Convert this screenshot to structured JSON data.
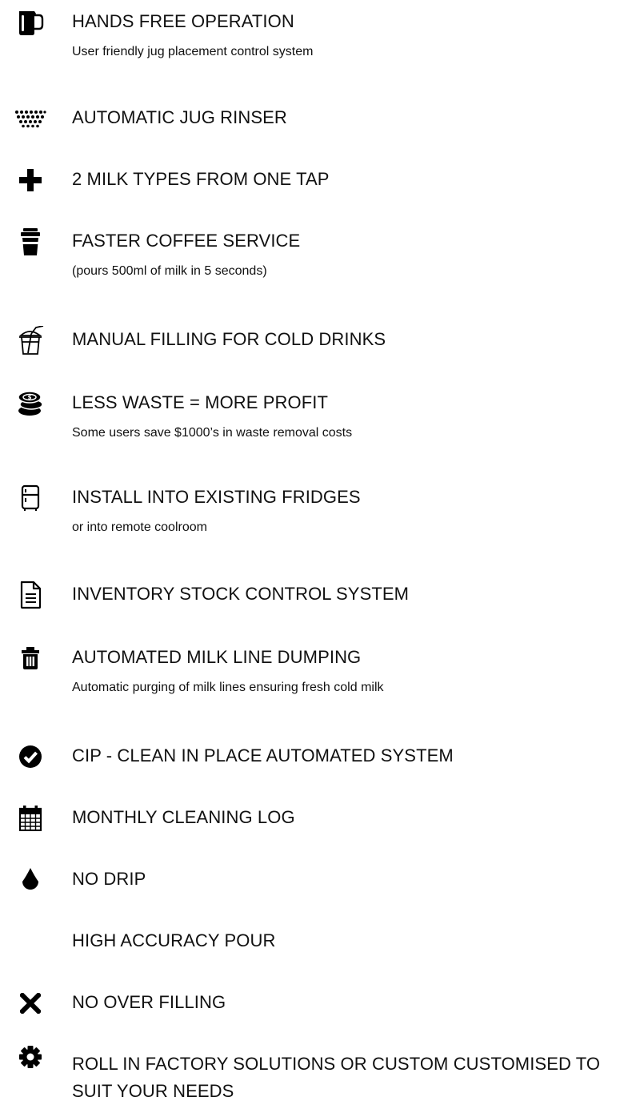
{
  "features": [
    {
      "icon": "milk-jug-icon",
      "title": "HANDS FREE OPERATION",
      "subtitle": "User friendly jug placement control system"
    },
    {
      "icon": "water-spray-icon",
      "title": "AUTOMATIC JUG RINSER"
    },
    {
      "icon": "plus-icon",
      "title": "2 MILK TYPES FROM ONE TAP"
    },
    {
      "icon": "takeaway-cup-icon",
      "title": "FASTER COFFEE SERVICE",
      "subtitle": "(pours 500ml of milk in 5 seconds)"
    },
    {
      "icon": "cold-drink-cup-icon",
      "title": "MANUAL FILLING FOR COLD DRINKS"
    },
    {
      "icon": "coin-stack-icon",
      "title": "LESS WASTE = MORE PROFIT",
      "subtitle": "Some users save $1000’s in waste removal costs"
    },
    {
      "icon": "fridge-icon",
      "title": "INSTALL INTO EXISTING FRIDGES",
      "subtitle": "or into remote coolroom"
    },
    {
      "icon": "document-icon",
      "title": "INVENTORY STOCK CONTROL SYSTEM"
    },
    {
      "icon": "trash-icon",
      "title": "AUTOMATED MILK LINE DUMPING",
      "subtitle": "Automatic purging of milk lines ensuring fresh cold milk"
    },
    {
      "icon": "check-circle-icon",
      "title": "CIP - CLEAN IN PLACE AUTOMATED SYSTEM"
    },
    {
      "icon": "calendar-icon",
      "title": "MONTHLY CLEANING LOG"
    },
    {
      "icon": "droplet-icon",
      "title": "NO DRIP"
    },
    {
      "icon": "",
      "title": "HIGH ACCURACY POUR"
    },
    {
      "icon": "x-mark-icon",
      "title": "NO OVER FILLING"
    },
    {
      "icon": "gear-icon",
      "title": "ROLL IN FACTORY SOLUTIONS OR CUSTOM CUSTOMISED TO SUIT YOUR NEEDS"
    }
  ]
}
